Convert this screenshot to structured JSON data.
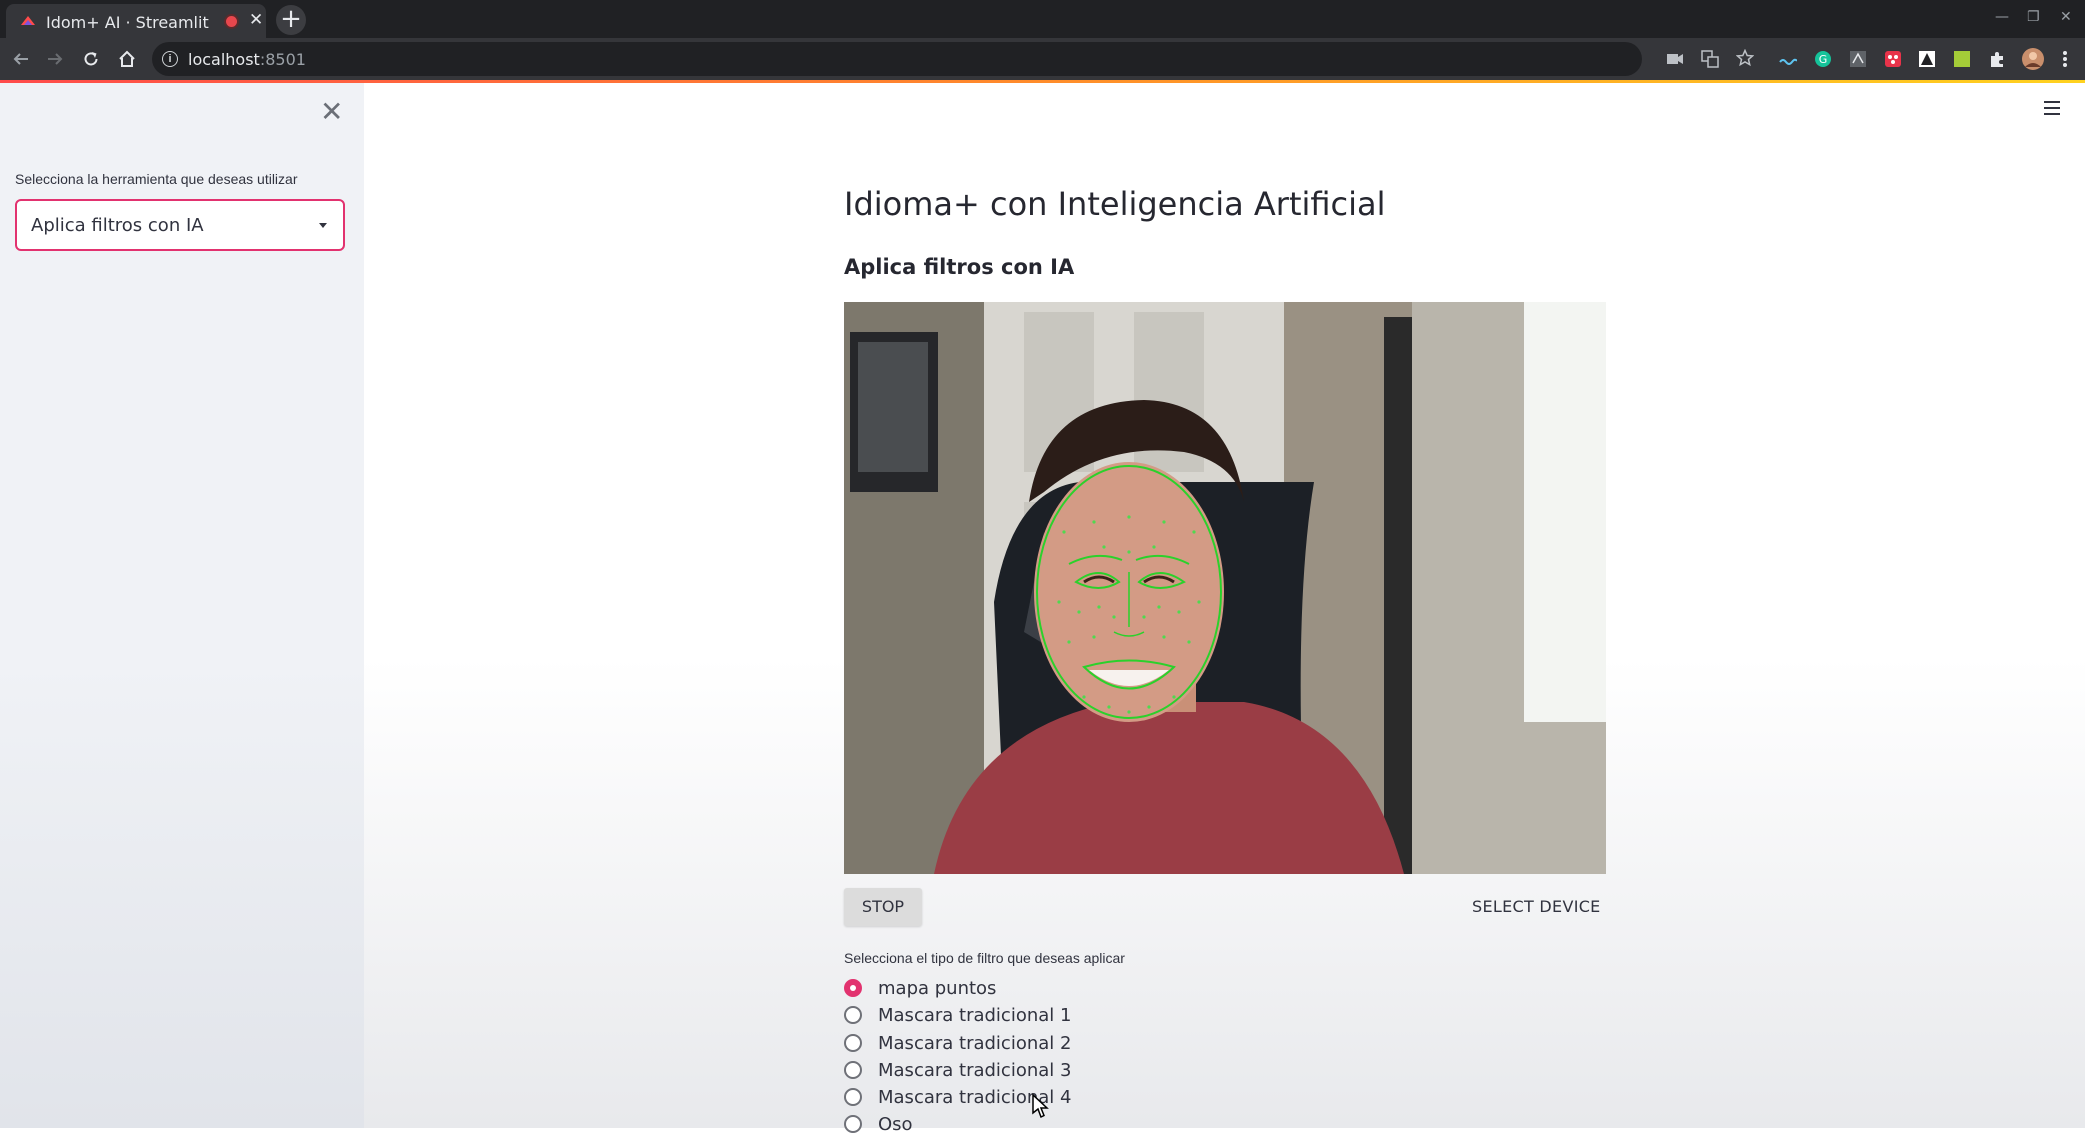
{
  "browser": {
    "tab_title": "Idom+ AI · Streamlit",
    "new_tab": "+",
    "url_host": "localhost",
    "url_port": ":8501"
  },
  "sidebar": {
    "close_icon": "close-icon",
    "select_label": "Selecciona la herramienta que deseas utilizar",
    "select_value": "Aplica filtros con IA"
  },
  "main": {
    "title": "Idioma+ con Inteligencia Artificial",
    "subheader": "Aplica filtros con IA",
    "stop_label": "STOP",
    "select_device_label": "SELECT DEVICE",
    "radio_label": "Selecciona el tipo de filtro que deseas aplicar",
    "radio_options": [
      "mapa puntos",
      "Mascara tradicional 1",
      "Mascara tradicional 2",
      "Mascara tradicional 3",
      "Mascara tradicional 4",
      "Oso"
    ],
    "radio_selected_index": 0
  },
  "colors": {
    "accent": "#e2326f",
    "sidebar_bg": "#f0f2f6",
    "chrome_dark": "#202124",
    "landmark_green": "#2bd12b"
  }
}
